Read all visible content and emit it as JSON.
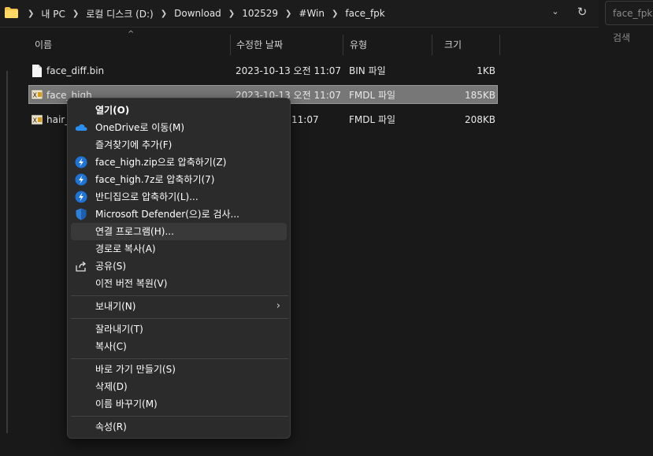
{
  "address": {
    "breadcrumbs": [
      "내 PC",
      "로컬 디스크 (D:)",
      "Download",
      "102529",
      "#Win",
      "face_fpk"
    ],
    "search_placeholder": "face_fpk 검색"
  },
  "columns": [
    {
      "label": "이름"
    },
    {
      "label": "수정한 날짜"
    },
    {
      "label": "유형"
    },
    {
      "label": "크기"
    }
  ],
  "files": [
    {
      "name": "face_diff.bin",
      "date": "2023-10-13 오전 11:07",
      "type": "BIN 파일",
      "size": "1KB",
      "icon": "file-icon",
      "selected": false
    },
    {
      "name": "face_high",
      "date": "2023-10-13 오전 11:07",
      "type": "FMDL 파일",
      "size": "185KB",
      "icon": "fmdl-file-icon",
      "selected": true
    },
    {
      "name": "hair_",
      "date": "11:07",
      "type": "FMDL 파일",
      "size": "208KB",
      "icon": "fmdl-file-icon",
      "selected": false
    }
  ],
  "context_menu": {
    "groups": [
      [
        {
          "label": "열기(O)",
          "bold": true,
          "icon": ""
        },
        {
          "label": "OneDrive로 이동(M)",
          "icon": "onedrive-cloud-icon"
        },
        {
          "label": "즐겨찾기에 추가(F)",
          "icon": ""
        },
        {
          "label": "face_high.zip으로 압축하기(Z)",
          "icon": "bandizip-icon"
        },
        {
          "label": "face_high.7z로 압축하기(7)",
          "icon": "bandizip-icon"
        },
        {
          "label": "반디집으로 압축하기(L)...",
          "icon": "bandizip-icon"
        },
        {
          "label": "Microsoft Defender(으)로 검사...",
          "icon": "defender-shield-icon"
        },
        {
          "label": "연결 프로그램(H)...",
          "icon": "",
          "hover": true
        },
        {
          "label": "경로로 복사(A)",
          "icon": ""
        },
        {
          "label": "공유(S)",
          "icon": "share-icon"
        },
        {
          "label": "이전 버전 복원(V)",
          "icon": ""
        }
      ],
      [
        {
          "label": "보내기(N)",
          "icon": "",
          "submenu": true
        }
      ],
      [
        {
          "label": "잘라내기(T)",
          "icon": ""
        },
        {
          "label": "복사(C)",
          "icon": ""
        }
      ],
      [
        {
          "label": "바로 가기 만들기(S)",
          "icon": ""
        },
        {
          "label": "삭제(D)",
          "icon": ""
        },
        {
          "label": "이름 바꾸기(M)",
          "icon": ""
        }
      ],
      [
        {
          "label": "속성(R)",
          "icon": ""
        }
      ]
    ]
  },
  "colors": {
    "background": "#191919",
    "menu_bg": "#2b2b2b",
    "selection": "#777777",
    "onedrive": "#2b8ff0",
    "bandizip": "#1e73d6",
    "defender": "#2f7fd8"
  }
}
